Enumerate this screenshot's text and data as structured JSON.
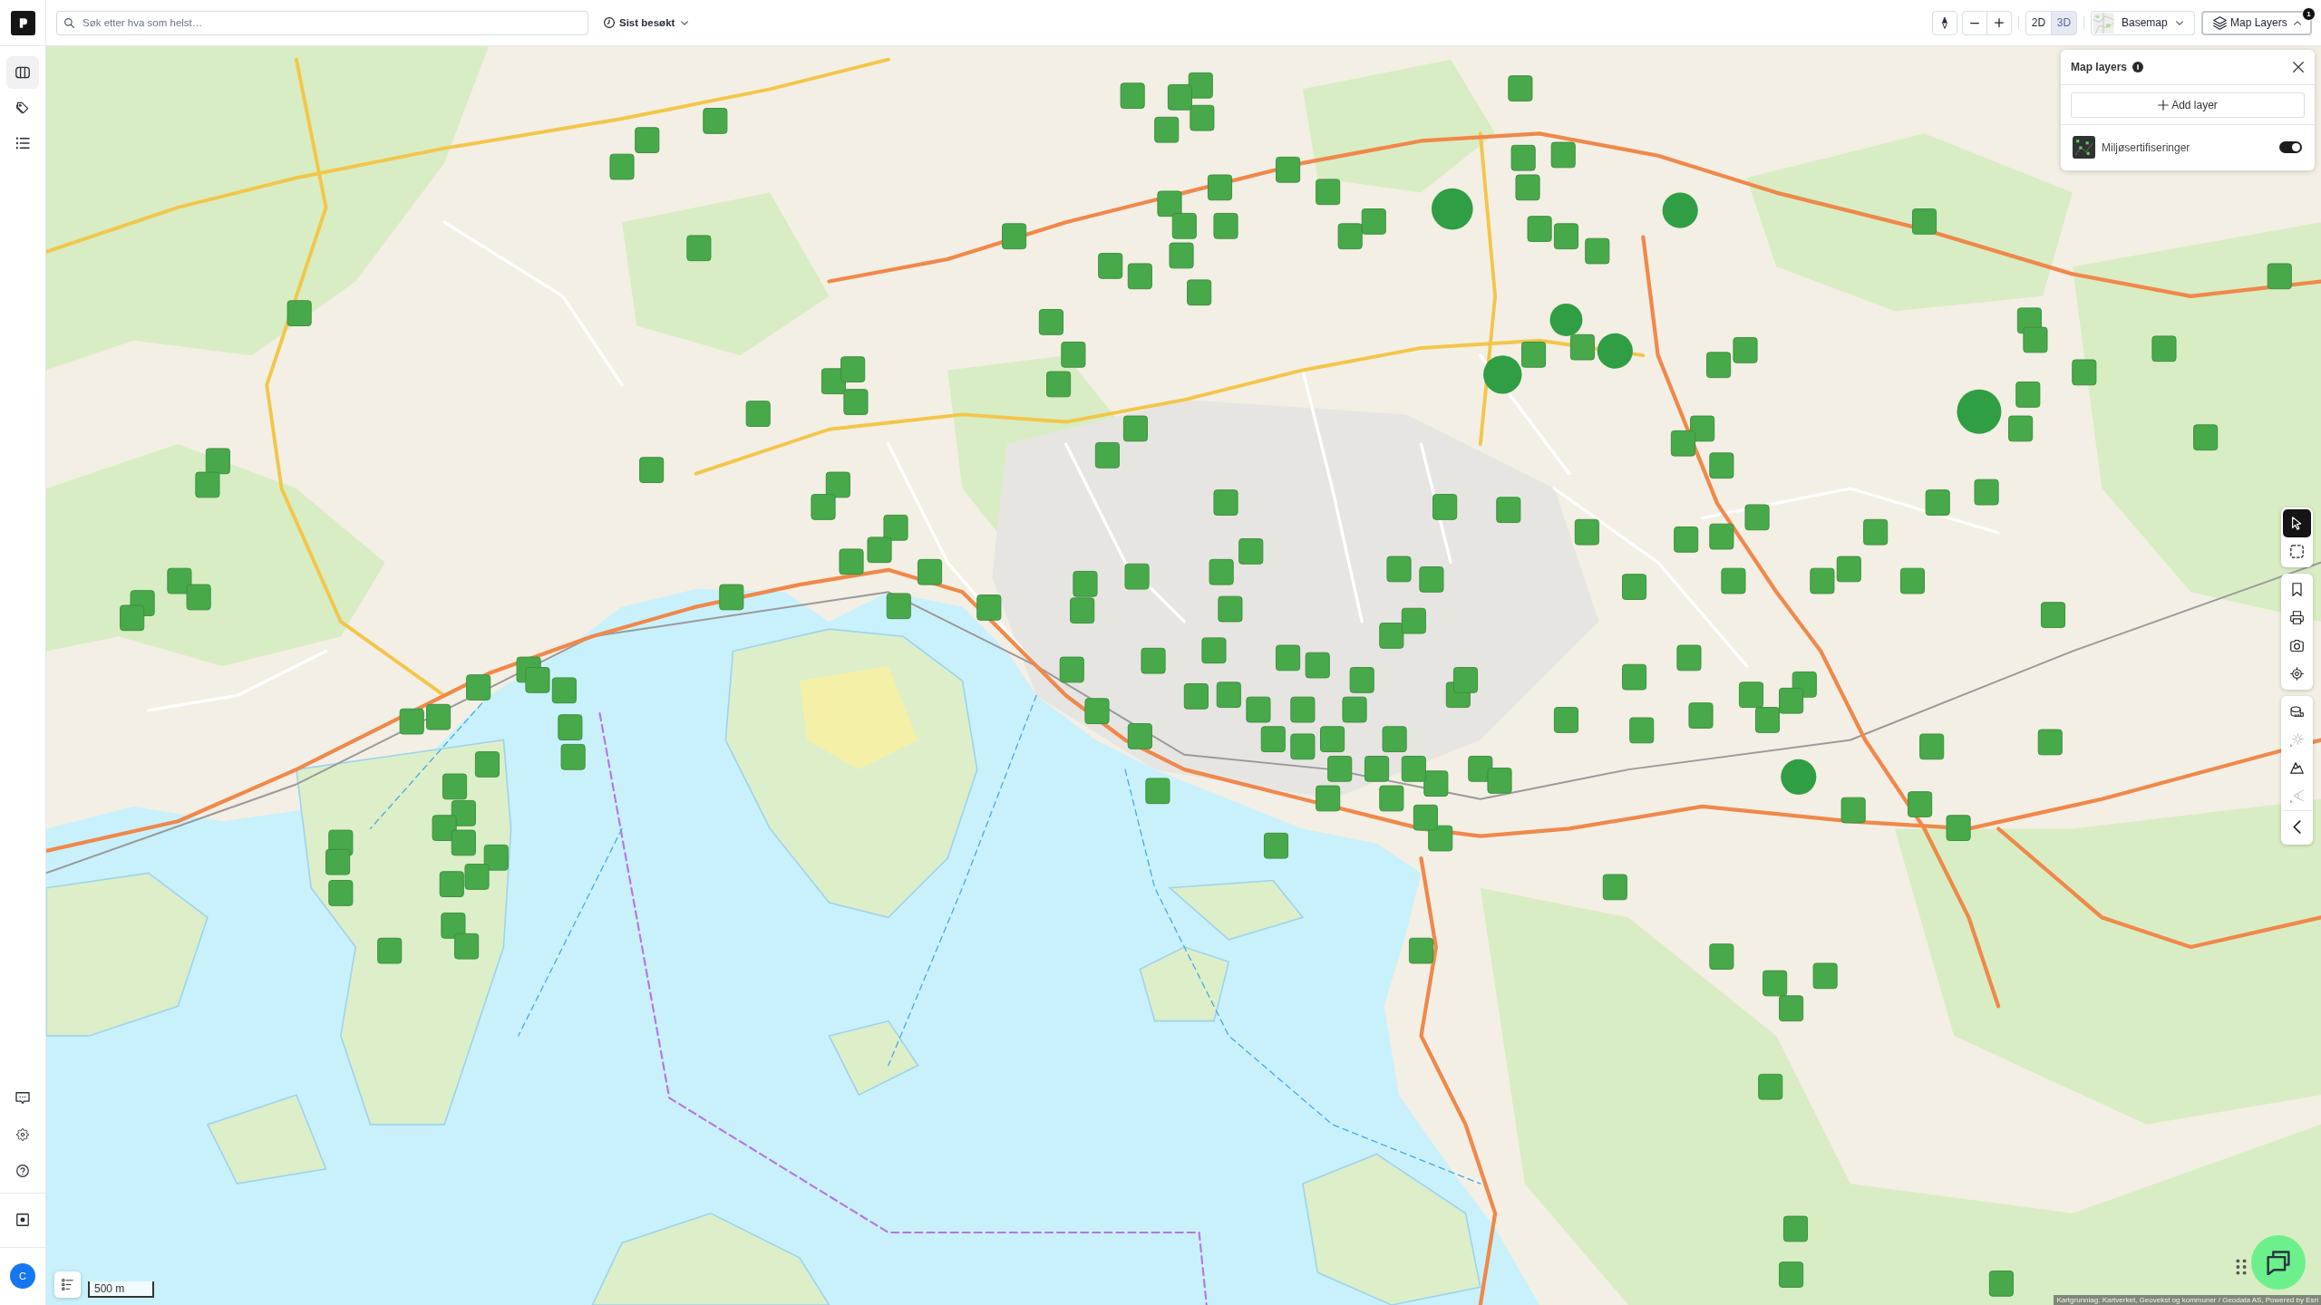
{
  "sidebar": {
    "items": [
      {
        "kind": "map",
        "selected": true
      },
      {
        "kind": "tags",
        "selected": false
      },
      {
        "kind": "list",
        "selected": false
      }
    ],
    "footer_items": [
      {
        "kind": "comment"
      },
      {
        "kind": "settings"
      },
      {
        "kind": "help"
      }
    ],
    "recorder": {
      "kind": "record"
    },
    "avatar": {
      "initial": "C"
    }
  },
  "top_bar": {
    "search": {
      "placeholder": "Søk etter hva som helst…"
    },
    "recent": {
      "label": "Sist besøkt"
    },
    "view_modes": [
      {
        "label": "2D",
        "selected": false
      },
      {
        "label": "3D",
        "selected": true
      }
    ],
    "basemap": {
      "label": "Basemap"
    },
    "map_layers": {
      "label": "Map Layers",
      "badge": "1",
      "expanded": true
    }
  },
  "layers_panel": {
    "title": "Map layers",
    "add_button": "Add layer",
    "layers": [
      {
        "name": "Miljøsertifiseringer",
        "on": true
      }
    ]
  },
  "tool_groups": [
    {
      "items": [
        {
          "kind": "pointer",
          "selected": true
        },
        {
          "kind": "box-select",
          "selected": false
        }
      ]
    },
    {
      "items": [
        {
          "kind": "bookmark"
        },
        {
          "kind": "print"
        },
        {
          "kind": "camera"
        },
        {
          "kind": "locate"
        }
      ]
    },
    {
      "items": [
        {
          "kind": "measure",
          "disabled": false
        },
        {
          "kind": "sun",
          "disabled": true
        },
        {
          "kind": "terrain",
          "disabled": false
        },
        {
          "kind": "angle",
          "disabled": true
        },
        {
          "kind": "collapse",
          "disabled": false
        }
      ]
    }
  ],
  "scale_bar": {
    "label": "500 m"
  },
  "attribution": "Kartgrunnlag: Kartverket, Geovekst og kommuner / Geodata AS, Powered by Esri"
}
